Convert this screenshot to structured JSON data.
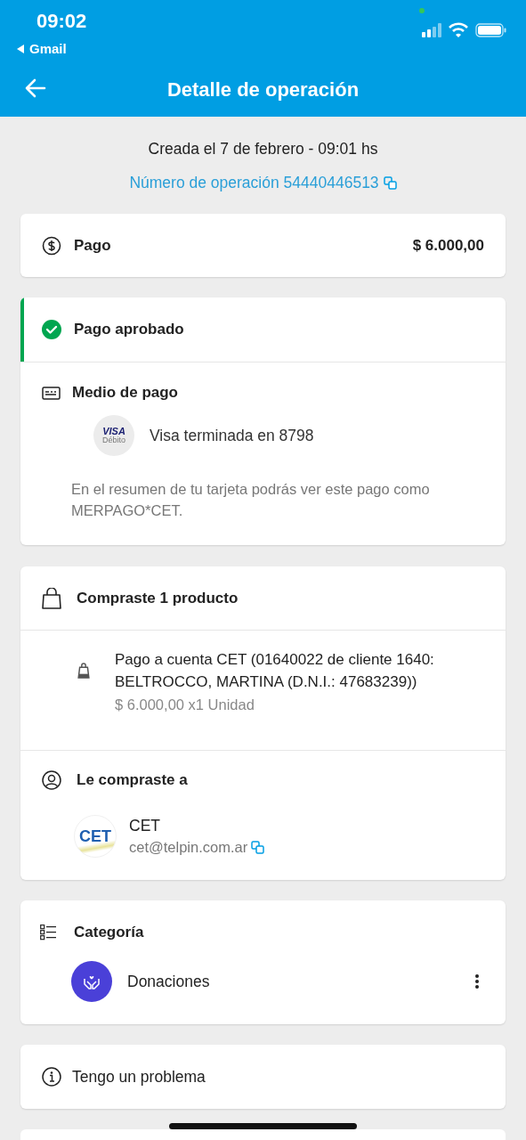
{
  "status_bar": {
    "time": "09:02",
    "back_app": "Gmail"
  },
  "header": {
    "title": "Detalle de operación"
  },
  "summary": {
    "created": "Creada el 7 de febrero - 09:01 hs",
    "operation_number": "Número de operación 54440446513"
  },
  "payment": {
    "label": "Pago",
    "amount": "$ 6.000,00"
  },
  "status": {
    "label": "Pago aprobado",
    "approved": true
  },
  "payment_method": {
    "title": "Medio de pago",
    "card_brand": "VISA",
    "card_type": "Débito",
    "card": "Visa terminada en 8798",
    "note": "En el resumen de tu tarjeta podrás ver este pago como MERPAGO*CET."
  },
  "purchase": {
    "title": "Compraste 1 producto",
    "items": [
      {
        "description": "Pago a cuenta CET (01640022 de cliente 1640: BELTROCCO, MARTINA (D.N.I.: 47683239))",
        "price": "$ 6.000,00 x1 Unidad"
      }
    ]
  },
  "seller": {
    "title": "Le compraste a",
    "logo_text": "CET",
    "name": "CET",
    "email": "cet@telpin.com.ar"
  },
  "category": {
    "title": "Categoría",
    "name": "Donaciones"
  },
  "help": {
    "label": "Tengo un problema"
  }
}
